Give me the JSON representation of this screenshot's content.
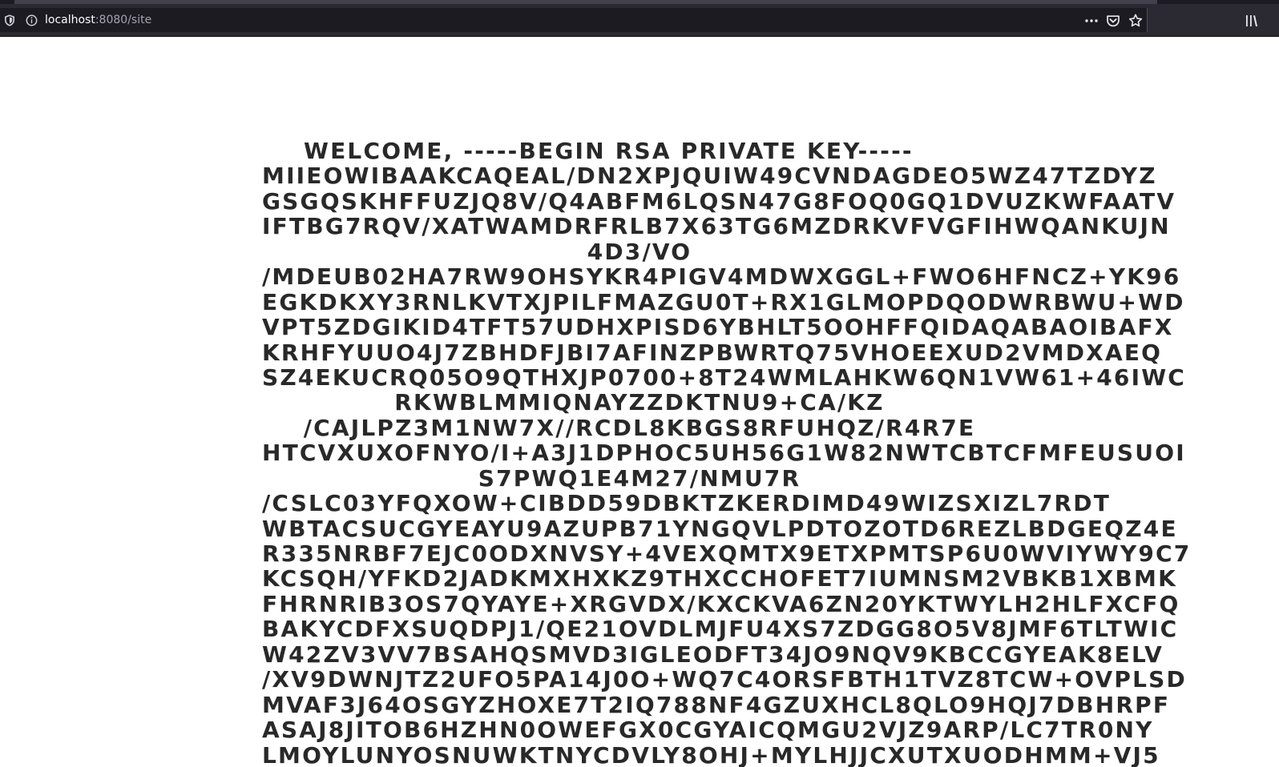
{
  "browser": {
    "url_host": "localhost",
    "url_rest": ":8080/site",
    "icons": {
      "shield": "tracking-protection-shield-icon",
      "info": "site-information-icon",
      "more": "page-actions-more-icon",
      "pocket": "pocket-icon",
      "bookmark": "bookmark-star-icon",
      "library": "library-icon"
    }
  },
  "page": {
    "welcome_lines": [
      "WELCOME, -----BEGIN RSA PRIVATE KEY-----",
      "MIIEOWIBAAKCAQEAL/DN2XPJQUIW49CVNDAGDEO5WZ47TZDYZ",
      "GSGQSKHFFUZJQ8V/Q4ABFM6LQSN47G8FOQ0GQ1DVUZKWFAATV",
      "IFTBG7RQV/XATWAMDRFRLB7X63TG6MZDRKVFVGFIHWQANKUJN",
      "4D3/VO",
      "/MDEUB02HA7RW9OHSYKR4PIGV4MDWXGGL+FWO6HFNCZ+YK96",
      "EGKDKXY3RNLKVTXJPILFMAZGU0T+RX1GLMOPDQODWRBWU+WD",
      "VPT5ZDGIKID4TFT57UDHXPISD6YBHLT5OOHFFQIDAQABAOIBAFX",
      "KRHFYUUO4J7ZBHDFJBI7AFINZPBWRTQ75VHOEEXUD2VMDXAEQ",
      "SZ4EKUCRQ05O9QTHXJP0700+8T24WMLAHKW6QN1VW61+46IWC",
      "RKWBLMMIQNAYZZDKTNU9+CA/KZ",
      "/CAJLPZ3M1NW7X//RCDL8KBGS8RFUHQZ/R4R7E",
      "HTCVXUXOFNYO/I+A3J1DPHOC5UH56G1W82NWTCBTCFMFEUSUOI",
      "S7PWQ1E4M27/NMU7R",
      "/CSLC03YFQXOW+CIBDD59DBKTZKERDIMD49WIZSXIZL7RDT",
      "WBTACSUCGYEAYU9AZUPB71YNGQVLPDTOZOTD6REZLBDGEQZ4E",
      "R335NRBF7EJC0ODXNVSY+4VEXQMTX9ETXPMTSP6U0WVIYWY9C7",
      "KCSQH/YFKD2JADKMXHXKZ9THXCCHOFET7IUMNSM2VBKB1XBMK",
      "FHRNRIB3OS7QYAYE+XRGVDX/KXCKVA6ZN20YKTWYLH2HLFXCFQ",
      "BAKYCDFXSUQDPJ1/QE21OVDLMJFU4XS7ZDGG8O5V8JMF6TLTWIC",
      "W42ZV3VV7BSAHQSMVD3IGLEODFT34JO9NQV9KBCCGYEAK8ELV",
      "/XV9DWNJTZ2UFO5PA14J0O+WQ7C4ORSFBTH1TVZ8TCW+OVPLSD",
      "MVAF3J64OSGYZHOXE7T2IQ788NF4GZUXHCL8QLO9HQJ7DBHRPF",
      "ASAJ8JITOB6HZHN0OWEFGX0CGYAICQMGU2VJZ9ARP/LC7TR0NY",
      "LMOYLUNYOSNUWKTNYCDVLY8OHJ+MYLHJJCXUTXUODHMM+VJ5"
    ]
  }
}
